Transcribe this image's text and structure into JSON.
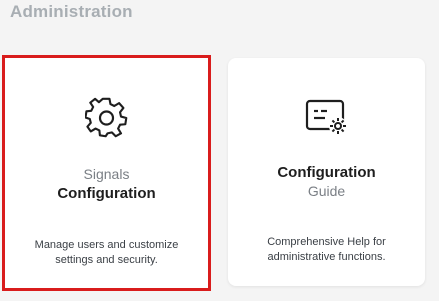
{
  "section": {
    "title": "Administration"
  },
  "cards": [
    {
      "icon": "gear-icon",
      "line1": "Signals",
      "line2": "Configuration",
      "description": "Manage users and customize settings and security.",
      "selected": true,
      "highlight_color": "#d91c1c"
    },
    {
      "icon": "settings-panel-icon",
      "line1": "Configuration",
      "line2": "Guide",
      "description": "Comprehensive Help for administrative functions.",
      "selected": false
    }
  ]
}
